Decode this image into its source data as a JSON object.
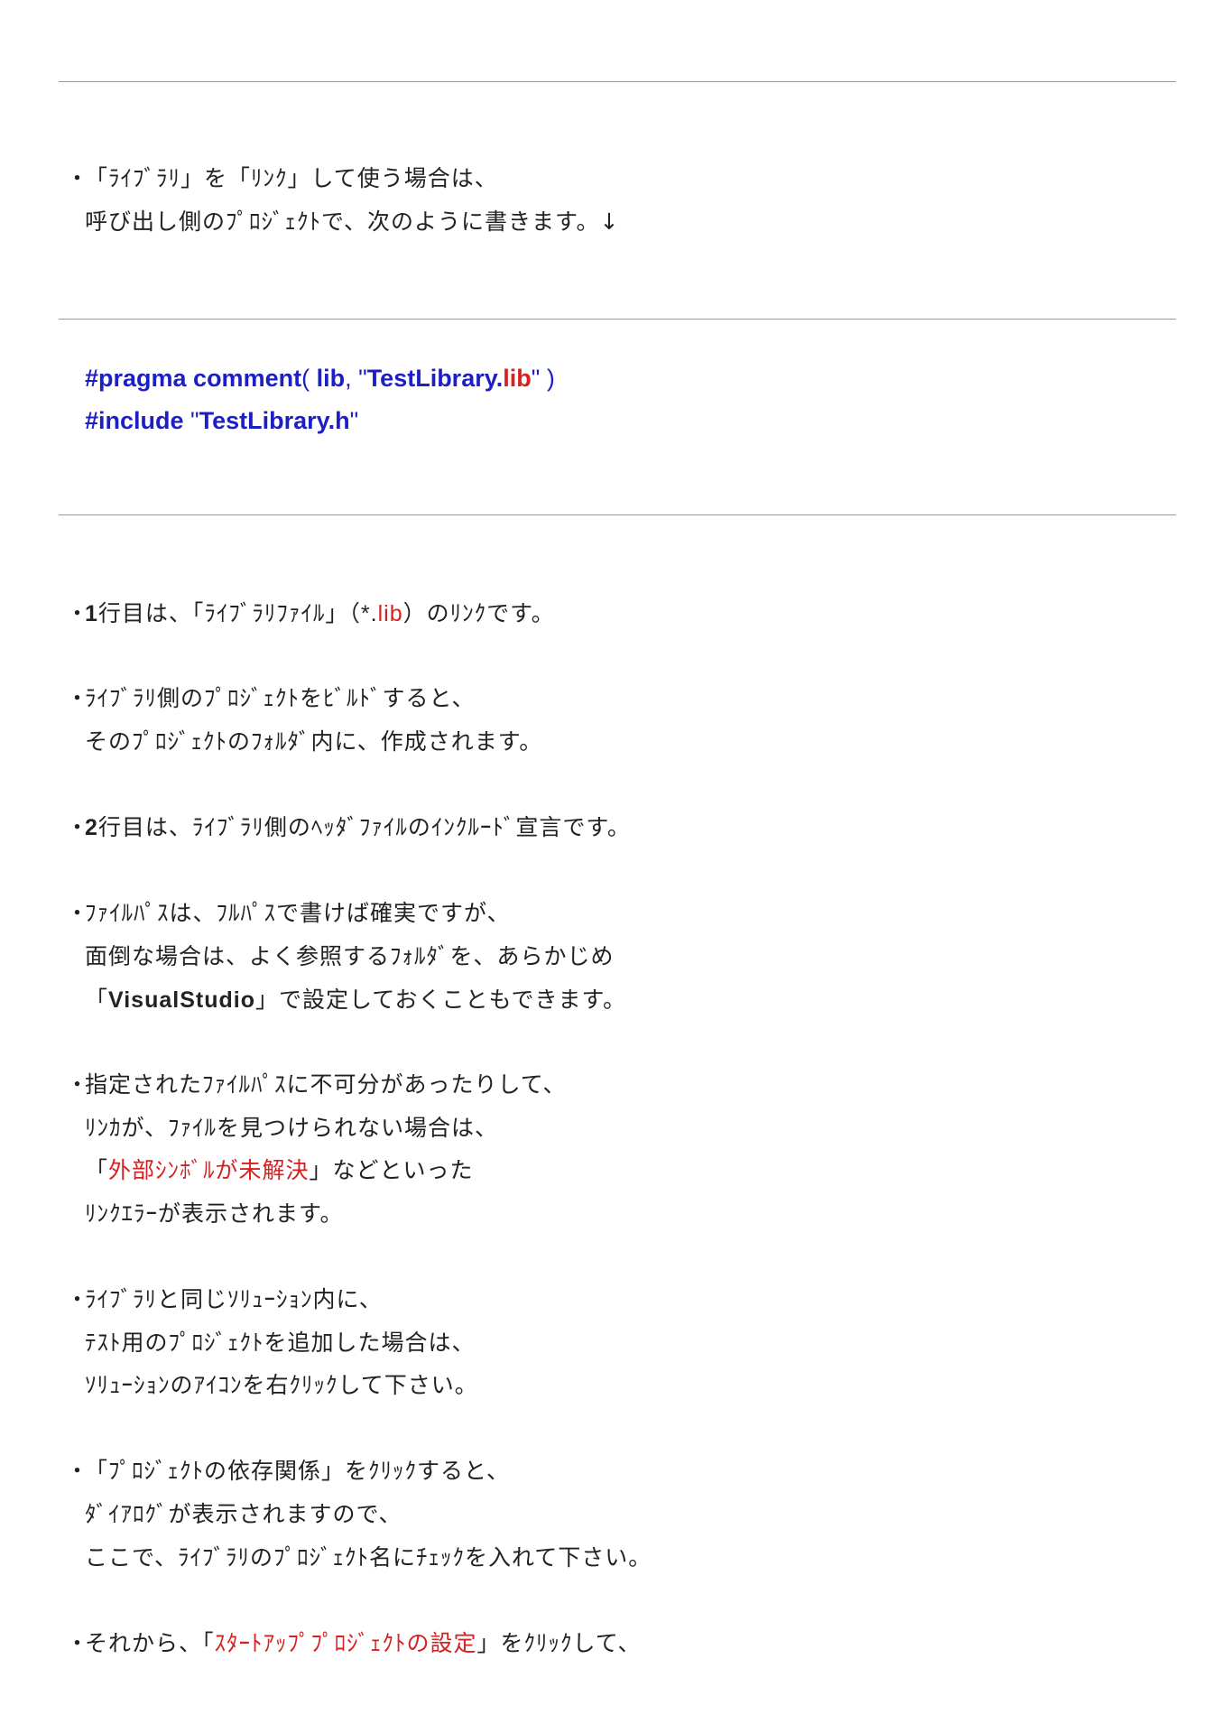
{
  "intro": {
    "line1": "「ﾗｲﾌﾞﾗﾘ」を「ﾘﾝｸ」して使う場合は、",
    "line2": "呼び出し側のﾌﾟﾛｼﾞｪｸﾄで、次のように書きます。↓"
  },
  "code": {
    "line1": {
      "directive": "#pragma comment",
      "paren_open": "( ",
      "arg1": "lib",
      "comma": ", ",
      "quote_open": "\"",
      "file": "TestLibrary.",
      "ext": "lib",
      "quote_close": "\"",
      "paren_close": " )"
    },
    "line2": {
      "directive": "#include",
      "quote_open": " \"",
      "file": "TestLibrary.h",
      "quote_close": "\""
    }
  },
  "notes": {
    "n1": {
      "num": "1",
      "pre": "行目は、「ﾗｲﾌﾞﾗﾘﾌｧｲﾙ」（",
      "star": "*.",
      "ext": "lib",
      "post": "）のﾘﾝｸです。"
    },
    "n2": {
      "line1": "ﾗｲﾌﾞﾗﾘ側のﾌﾟﾛｼﾞｪｸﾄをﾋﾞﾙﾄﾞすると、",
      "line2": "そのﾌﾟﾛｼﾞｪｸﾄのﾌｫﾙﾀﾞ内に、作成されます。"
    },
    "n3": {
      "num": "2",
      "text": "行目は、ﾗｲﾌﾞﾗﾘ側のﾍｯﾀﾞﾌｧｲﾙのｲﾝｸﾙｰﾄﾞ宣言です。"
    },
    "n4": {
      "line1": "ﾌｧｲﾙﾊﾟｽは、ﾌﾙﾊﾟｽで書けば確実ですが、",
      "line2": "面倒な場合は、よく参照するﾌｫﾙﾀﾞを、あらかじめ",
      "line3_open": "「",
      "line3_bold": "VisualStudio",
      "line3_rest": "」で設定しておくこともできます。"
    },
    "n5": {
      "line1": "指定されたﾌｧｲﾙﾊﾟｽに不可分があったりして、",
      "line2": "ﾘﾝｶが、ﾌｧｲﾙを見つけられない場合は、",
      "line3_open": "「",
      "line3_red": "外部ｼﾝﾎﾞﾙが未解決",
      "line3_rest": "」などといった",
      "line4": "ﾘﾝｸｴﾗｰが表示されます。"
    },
    "n6": {
      "line1": "ﾗｲﾌﾞﾗﾘと同じｿﾘｭｰｼｮﾝ内に、",
      "line2": "ﾃｽﾄ用のﾌﾟﾛｼﾞｪｸﾄを追加した場合は、",
      "line3": "ｿﾘｭｰｼｮﾝのｱｲｺﾝを右ｸﾘｯｸして下さい。"
    },
    "n7": {
      "line1": "「ﾌﾟﾛｼﾞｪｸﾄの依存関係」をｸﾘｯｸすると、",
      "line2": "ﾀﾞｲｱﾛｸﾞが表示されますので、",
      "line3": "ここで、ﾗｲﾌﾞﾗﾘのﾌﾟﾛｼﾞｪｸﾄ名にﾁｪｯｸを入れて下さい。"
    },
    "n8": {
      "pre": "それから、「",
      "red": "ｽﾀｰﾄｱｯﾌﾟﾌﾟﾛｼﾞｪｸﾄの設定",
      "post": "」をｸﾘｯｸして、"
    }
  },
  "bullet_char": "・"
}
